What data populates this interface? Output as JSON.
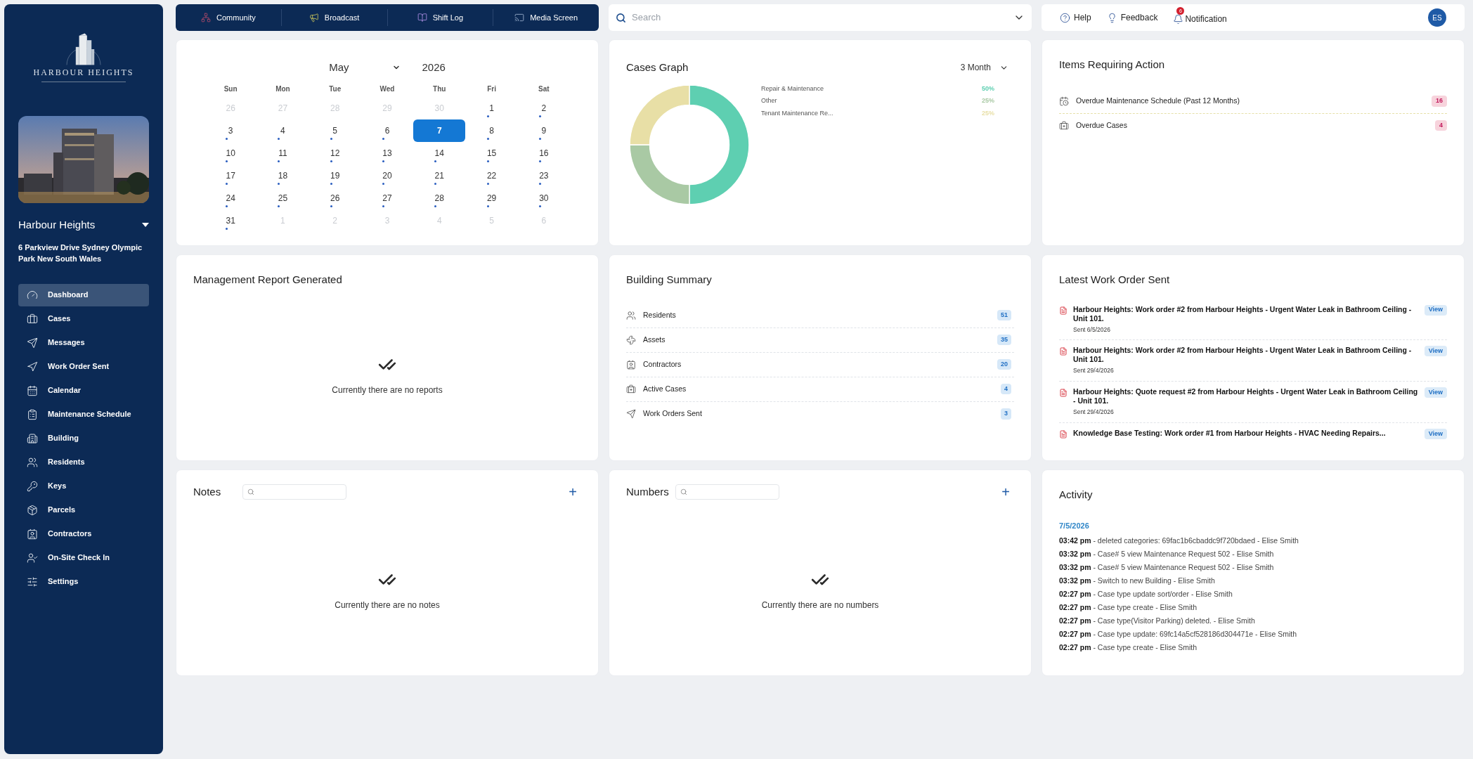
{
  "sidebar": {
    "logo_text": "HARBOUR HEIGHTS",
    "building_name": "Harbour Heights",
    "address": "6 Parkview Drive Sydney Olympic Park New South Wales",
    "items": [
      {
        "label": "Dashboard",
        "selected": true
      },
      {
        "label": "Cases",
        "selected": false
      },
      {
        "label": "Messages",
        "selected": false
      },
      {
        "label": "Work Order Sent",
        "selected": false
      },
      {
        "label": "Calendar",
        "selected": false
      },
      {
        "label": "Maintenance Schedule",
        "selected": false
      },
      {
        "label": "Building",
        "selected": false
      },
      {
        "label": "Residents",
        "selected": false
      },
      {
        "label": "Keys",
        "selected": false
      },
      {
        "label": "Parcels",
        "selected": false
      },
      {
        "label": "Contractors",
        "selected": false
      },
      {
        "label": "On-Site Check In",
        "selected": false
      },
      {
        "label": "Settings",
        "selected": false
      }
    ]
  },
  "top_nav": [
    "Community",
    "Broadcast",
    "Shift Log",
    "Media Screen"
  ],
  "search": {
    "placeholder": "Search"
  },
  "header": {
    "help": "Help",
    "feedback": "Feedback",
    "notification": "Notification",
    "notification_count": "6",
    "avatar": "ES"
  },
  "calendar": {
    "month": "May",
    "year": "2026",
    "weekdays": [
      "Sun",
      "Mon",
      "Tue",
      "Wed",
      "Thu",
      "Fri",
      "Sat"
    ],
    "days": [
      {
        "label": "26",
        "muted": true,
        "dot": false,
        "selected": false
      },
      {
        "label": "27",
        "muted": true,
        "dot": false,
        "selected": false
      },
      {
        "label": "28",
        "muted": true,
        "dot": false,
        "selected": false
      },
      {
        "label": "29",
        "muted": true,
        "dot": false,
        "selected": false
      },
      {
        "label": "30",
        "muted": true,
        "dot": false,
        "selected": false
      },
      {
        "label": "1",
        "muted": false,
        "dot": true,
        "selected": false
      },
      {
        "label": "2",
        "muted": false,
        "dot": true,
        "selected": false
      },
      {
        "label": "3",
        "muted": false,
        "dot": true,
        "selected": false
      },
      {
        "label": "4",
        "muted": false,
        "dot": true,
        "selected": false
      },
      {
        "label": "5",
        "muted": false,
        "dot": true,
        "selected": false
      },
      {
        "label": "6",
        "muted": false,
        "dot": true,
        "selected": false
      },
      {
        "label": "7",
        "muted": false,
        "dot": false,
        "selected": true
      },
      {
        "label": "8",
        "muted": false,
        "dot": true,
        "selected": false
      },
      {
        "label": "9",
        "muted": false,
        "dot": true,
        "selected": false
      },
      {
        "label": "10",
        "muted": false,
        "dot": true,
        "selected": false
      },
      {
        "label": "11",
        "muted": false,
        "dot": true,
        "selected": false
      },
      {
        "label": "12",
        "muted": false,
        "dot": true,
        "selected": false
      },
      {
        "label": "13",
        "muted": false,
        "dot": true,
        "selected": false
      },
      {
        "label": "14",
        "muted": false,
        "dot": true,
        "selected": false
      },
      {
        "label": "15",
        "muted": false,
        "dot": true,
        "selected": false
      },
      {
        "label": "16",
        "muted": false,
        "dot": true,
        "selected": false
      },
      {
        "label": "17",
        "muted": false,
        "dot": true,
        "selected": false
      },
      {
        "label": "18",
        "muted": false,
        "dot": true,
        "selected": false
      },
      {
        "label": "19",
        "muted": false,
        "dot": true,
        "selected": false
      },
      {
        "label": "20",
        "muted": false,
        "dot": true,
        "selected": false
      },
      {
        "label": "21",
        "muted": false,
        "dot": true,
        "selected": false
      },
      {
        "label": "22",
        "muted": false,
        "dot": true,
        "selected": false
      },
      {
        "label": "23",
        "muted": false,
        "dot": true,
        "selected": false
      },
      {
        "label": "24",
        "muted": false,
        "dot": true,
        "selected": false
      },
      {
        "label": "25",
        "muted": false,
        "dot": true,
        "selected": false
      },
      {
        "label": "26",
        "muted": false,
        "dot": true,
        "selected": false
      },
      {
        "label": "27",
        "muted": false,
        "dot": true,
        "selected": false
      },
      {
        "label": "28",
        "muted": false,
        "dot": true,
        "selected": false
      },
      {
        "label": "29",
        "muted": false,
        "dot": true,
        "selected": false
      },
      {
        "label": "30",
        "muted": false,
        "dot": true,
        "selected": false
      },
      {
        "label": "31",
        "muted": false,
        "dot": true,
        "selected": false
      },
      {
        "label": "1",
        "muted": true,
        "dot": false,
        "selected": false
      },
      {
        "label": "2",
        "muted": true,
        "dot": false,
        "selected": false
      },
      {
        "label": "3",
        "muted": true,
        "dot": false,
        "selected": false
      },
      {
        "label": "4",
        "muted": true,
        "dot": false,
        "selected": false
      },
      {
        "label": "5",
        "muted": true,
        "dot": false,
        "selected": false
      },
      {
        "label": "6",
        "muted": true,
        "dot": false,
        "selected": false
      }
    ]
  },
  "cases_graph": {
    "title": "Cases Graph",
    "period": "3 Month",
    "legend": [
      {
        "value": "50%",
        "color": "#5ecfb1"
      },
      {
        "value": "25%",
        "color": "#a9c9a4"
      },
      {
        "value": "25%",
        "color": "#e8dfa6"
      }
    ],
    "chart_data": {
      "type": "donut",
      "categories": [
        "Repair & Maintenance",
        "Other",
        "Tenant Maintenance Re..."
      ],
      "values": [
        50,
        25,
        25
      ]
    }
  },
  "items_requiring_action": {
    "title": "Items Requiring Action",
    "items": [
      {
        "label": "Overdue Maintenance Schedule (Past 12 Months)",
        "count": "16"
      },
      {
        "label": "Overdue Cases",
        "count": "4"
      }
    ]
  },
  "management_report": {
    "title": "Management Report Generated",
    "empty": "Currently there are no reports"
  },
  "building_summary": {
    "title": "Building Summary",
    "items": [
      {
        "label": "Residents",
        "count": "51"
      },
      {
        "label": "Assets",
        "count": "35"
      },
      {
        "label": "Contractors",
        "count": "20"
      },
      {
        "label": "Active Cases",
        "count": "4"
      },
      {
        "label": "Work Orders Sent",
        "count": "3"
      }
    ]
  },
  "latest_work_orders": {
    "title": "Latest Work Order Sent",
    "items": [
      {
        "title": "Harbour Heights: Work order #2 from Harbour Heights - Urgent Water Leak in Bathroom Ceiling - Unit 101.",
        "sent": "Sent 6/5/2026",
        "action": "View"
      },
      {
        "title": "Harbour Heights: Work order #2 from Harbour Heights - Urgent Water Leak in Bathroom Ceiling - Unit 101.",
        "sent": "Sent 29/4/2026",
        "action": "View"
      },
      {
        "title": "Harbour Heights: Quote request #2 from Harbour Heights - Urgent Water Leak in Bathroom Ceiling - Unit 101.",
        "sent": "Sent 29/4/2026",
        "action": "View"
      },
      {
        "title": "Knowledge Base Testing: Work order #1 from Harbour Heights - HVAC Needing Repairs...",
        "action": "View"
      }
    ]
  },
  "notes": {
    "title": "Notes",
    "empty": "Currently there are no notes",
    "add": "+"
  },
  "numbers": {
    "title": "Numbers",
    "empty": "Currently there are no numbers",
    "add": "+"
  },
  "activity": {
    "title": "Activity",
    "date": "7/5/2026",
    "entries": [
      {
        "time": "03:42 pm",
        "text": "- deleted categories: 69fac1b6cbaddc9f720bdaed - Elise Smith"
      },
      {
        "time": "03:32 pm",
        "text": "- Case# 5 view Maintenance Request 502 - Elise Smith"
      },
      {
        "time": "03:32 pm",
        "text": "- Case# 5 view Maintenance Request 502 - Elise Smith"
      },
      {
        "time": "03:32 pm",
        "text": "- Switch to new Building - Elise Smith"
      },
      {
        "time": "02:27 pm",
        "text": "- Case type update sort/order - Elise Smith"
      },
      {
        "time": "02:27 pm",
        "text": "- Case type create - Elise Smith"
      },
      {
        "time": "02:27 pm",
        "text": "- Case type(Visitor Parking) deleted. - Elise Smith"
      },
      {
        "time": "02:27 pm",
        "text": "- Case type update: 69fc14a5cf528186d304471e - Elise Smith"
      },
      {
        "time": "02:27 pm",
        "text": "- Case type create - Elise Smith"
      }
    ]
  }
}
